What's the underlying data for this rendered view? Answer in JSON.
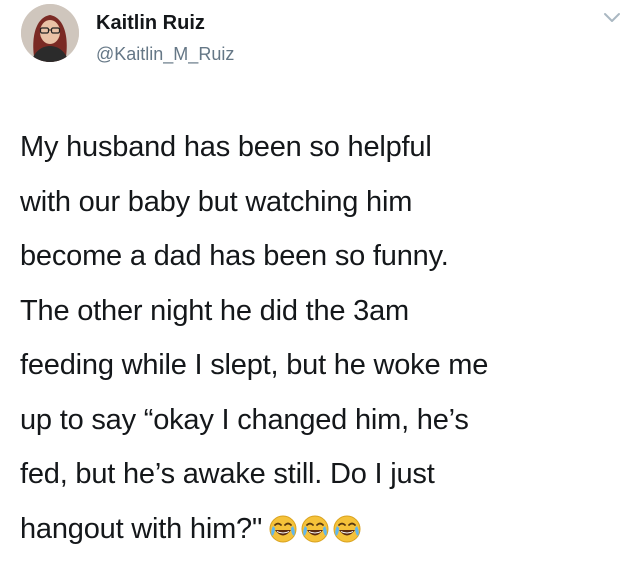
{
  "author": {
    "display_name": "Kaitlin Ruiz",
    "handle": "@Kaitlin_M_Ruiz"
  },
  "tweet": {
    "lines": [
      "My husband has been so helpful",
      "with our baby but watching him",
      "become a dad has been so funny.",
      "The other night he did the 3am",
      "feeding while I slept, but he woke me",
      "up to say “okay I changed him, he’s",
      "fed, but he’s awake still. Do I just",
      "hangout with him?\""
    ],
    "emojis": [
      "face-with-tears-of-joy",
      "face-with-tears-of-joy",
      "face-with-tears-of-joy"
    ]
  },
  "icons": {
    "more_menu": "chevron-down-icon"
  },
  "colors": {
    "text": "#14171a",
    "secondary": "#657786",
    "emoji_face": "#f5c23a"
  }
}
